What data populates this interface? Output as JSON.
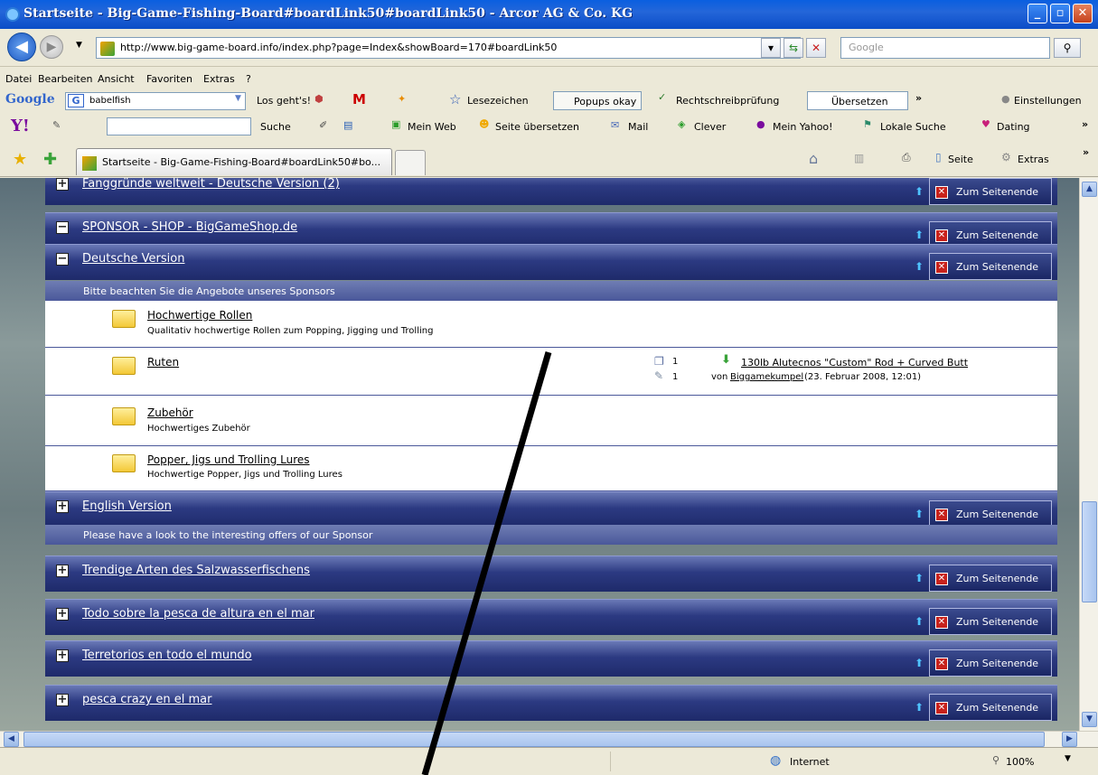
{
  "window": {
    "title": "Startseite - Big-Game-Fishing-Board#boardLink50#boardLink50 - Arcor AG & Co. KG",
    "minimize_icon": "minimize-icon",
    "maximize_icon": "maximize-icon",
    "close_icon": "close-icon"
  },
  "address": {
    "url": "http://www.big-game-board.info/index.php?page=Index&showBoard=170#boardLink50",
    "search_placeholder": "Google"
  },
  "menu": [
    "Datei",
    "Bearbeiten",
    "Ansicht",
    "Favoriten",
    "Extras",
    "?"
  ],
  "google_toolbar": {
    "logo": "Google",
    "search_value": "babelfish",
    "go_label": "Los geht's!",
    "bookmarks": "Lesezeichen",
    "popups": "Popups okay",
    "spell": "Rechtschreibprüfung",
    "translate": "Übersetzen",
    "more": "»",
    "settings": "Einstellungen"
  },
  "yahoo_toolbar": {
    "logo": "Y!",
    "search_label": "Suche",
    "myweb": "Mein Web",
    "translate_page": "Seite übersetzen",
    "mail": "Mail",
    "clever": "Clever",
    "my_yahoo": "Mein Yahoo!",
    "local": "Lokale Suche",
    "dating": "Dating",
    "more": "»"
  },
  "tabs": {
    "active": "Startseite - Big-Game-Fishing-Board#boardLink50#bo...",
    "page_menu": "Seite",
    "extras_menu": "Extras",
    "more": "»"
  },
  "forum": {
    "jump_label": "Zum Seitenende",
    "categories": [
      {
        "name": "Fanggründe weltweit - Deutsche Version (2)",
        "toggle": "+"
      },
      {
        "name": "SPONSOR - SHOP - BigGameShop.de",
        "toggle": "−"
      },
      {
        "name": "Deutsche Version",
        "toggle": "−"
      },
      {
        "name": "English Version",
        "toggle": "+"
      },
      {
        "name": "Trendige Arten des Salzwasserfischens",
        "toggle": "+"
      },
      {
        "name": "Todo sobre la pesca de altura en el mar",
        "toggle": "+"
      },
      {
        "name": "Terretorios en todo el mundo",
        "toggle": "+"
      },
      {
        "name": "pesca crazy en el mar",
        "toggle": "+"
      }
    ],
    "deutsch_note": "Bitte beachten Sie die Angebote unseres Sponsors",
    "english_note": "Please have a look to the interesting offers of our Sponsor",
    "boards": [
      {
        "name": "Hochwertige Rollen",
        "desc": "Qualitativ hochwertige Rollen zum Popping, Jigging und Trolling"
      },
      {
        "name": "Ruten",
        "desc": ""
      },
      {
        "name": "Zubehör",
        "desc": "Hochwertiges Zubehör"
      },
      {
        "name": "Popper, Jigs und Trolling Lures",
        "desc": "Hochwertige Popper, Jigs und Trolling Lures"
      }
    ],
    "ruten_stats": {
      "threads": "1",
      "posts": "1",
      "last_post_title": "130lb Alutecnos \"Custom\" Rod + Curved Butt",
      "last_post_by_prefix": "von",
      "last_post_user": "Biggamekumpel",
      "last_post_date": "(23. Februar 2008, 12:01)"
    }
  },
  "status": {
    "zone": "Internet",
    "zoom": "100%"
  }
}
